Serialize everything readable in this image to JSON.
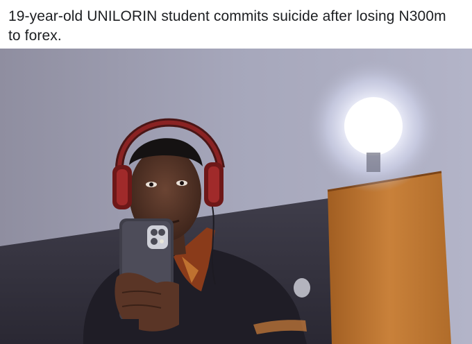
{
  "post": {
    "caption": "19-year-old UNILORIN student commits suicide after losing N300m to forex."
  },
  "photo": {
    "subject": "selfie-in-mirror",
    "icons": [
      "headphones-icon",
      "smartphone-icon",
      "ceiling-light-icon"
    ]
  },
  "colors": {
    "caption_text": "#1c1e21",
    "background": "#ffffff"
  }
}
